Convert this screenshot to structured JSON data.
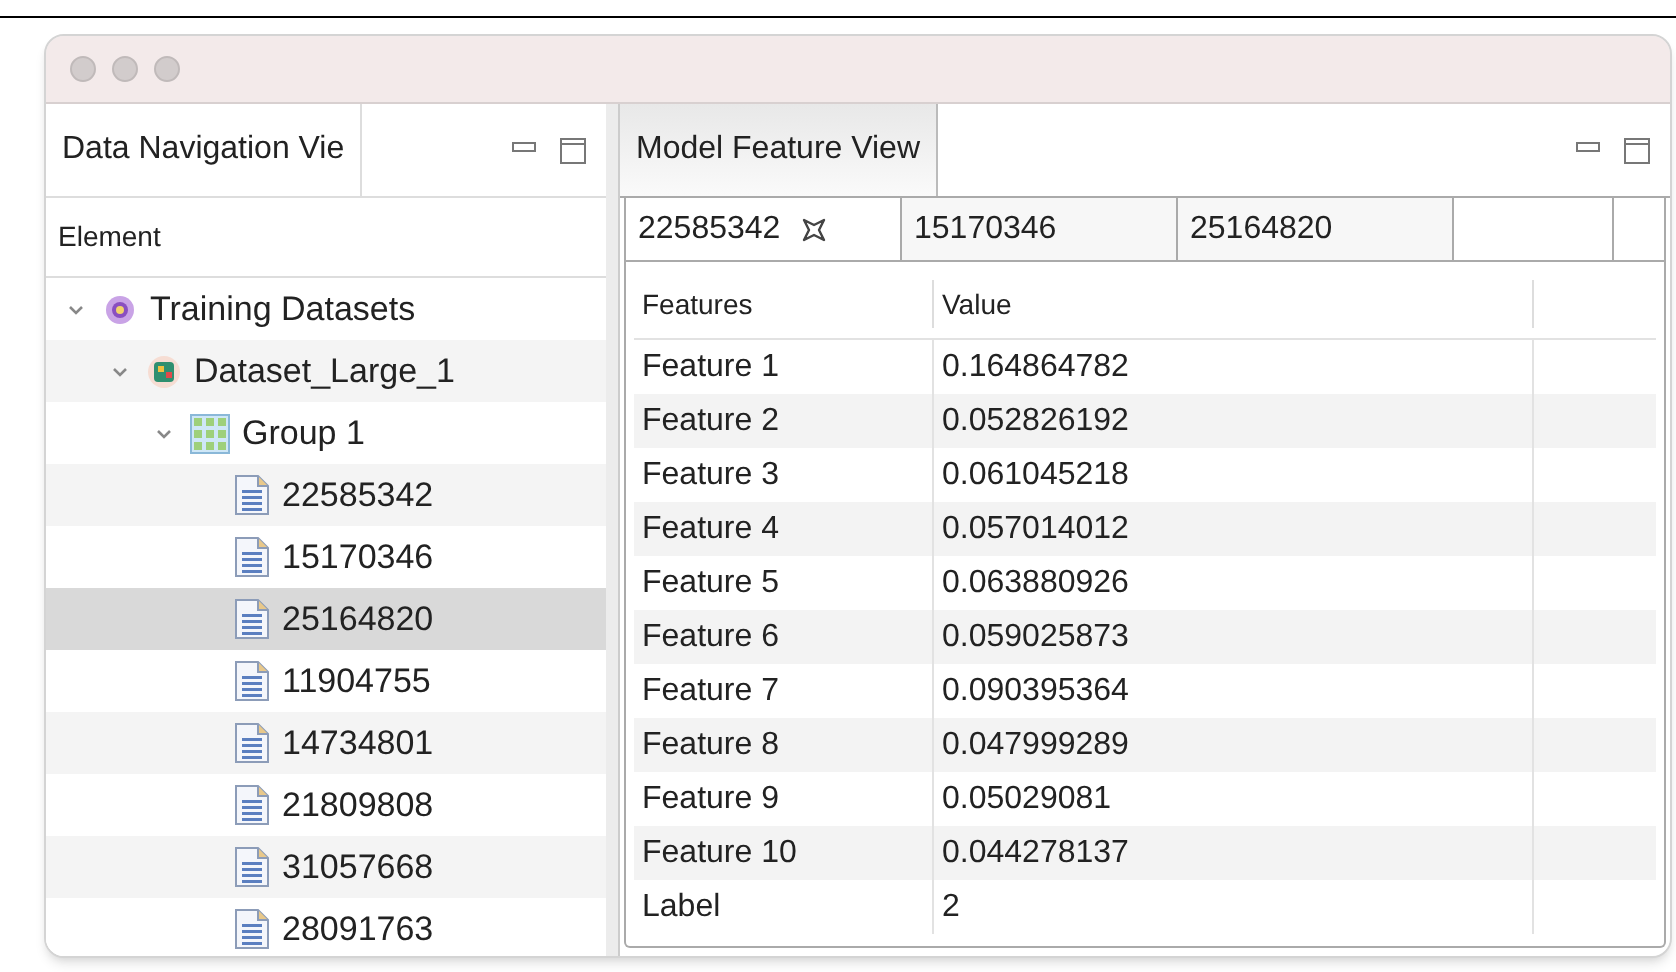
{
  "navigator": {
    "title": "Data Navigation Vie",
    "column": "Element",
    "tree": [
      {
        "label": "Training Datasets",
        "kind": "datasets",
        "expanded": true,
        "selected": false,
        "children": [
          {
            "label": "Dataset_Large_1",
            "kind": "dataset",
            "expanded": true,
            "selected": false,
            "children": [
              {
                "label": "Group 1",
                "kind": "group",
                "expanded": true,
                "selected": false,
                "children": [
                  {
                    "label": "22585342",
                    "kind": "file",
                    "selected": false
                  },
                  {
                    "label": "15170346",
                    "kind": "file",
                    "selected": false
                  },
                  {
                    "label": "25164820",
                    "kind": "file",
                    "selected": true
                  },
                  {
                    "label": "11904755",
                    "kind": "file",
                    "selected": false
                  },
                  {
                    "label": "14734801",
                    "kind": "file",
                    "selected": false
                  },
                  {
                    "label": "21809808",
                    "kind": "file",
                    "selected": false
                  },
                  {
                    "label": "31057668",
                    "kind": "file",
                    "selected": false
                  },
                  {
                    "label": "28091763",
                    "kind": "file",
                    "selected": false
                  }
                ]
              }
            ]
          }
        ]
      }
    ]
  },
  "feature_view": {
    "title": "Model Feature View",
    "tabs": [
      {
        "label": "22585342",
        "selected": true
      },
      {
        "label": "15170346",
        "selected": false
      },
      {
        "label": "25164820",
        "selected": false
      }
    ],
    "columns": [
      "Features",
      "Value"
    ],
    "rows": [
      [
        "Feature 1",
        "0.164864782"
      ],
      [
        "Feature 2",
        "0.052826192"
      ],
      [
        "Feature 3",
        "0.061045218"
      ],
      [
        "Feature 4",
        "0.057014012"
      ],
      [
        "Feature 5",
        "0.063880926"
      ],
      [
        "Feature 6",
        "0.059025873"
      ],
      [
        "Feature 7",
        "0.090395364"
      ],
      [
        "Feature 8",
        "0.047999289"
      ],
      [
        "Feature 9",
        "0.05029081"
      ],
      [
        "Feature 10",
        "0.044278137"
      ],
      [
        "Label",
        "2"
      ]
    ]
  }
}
